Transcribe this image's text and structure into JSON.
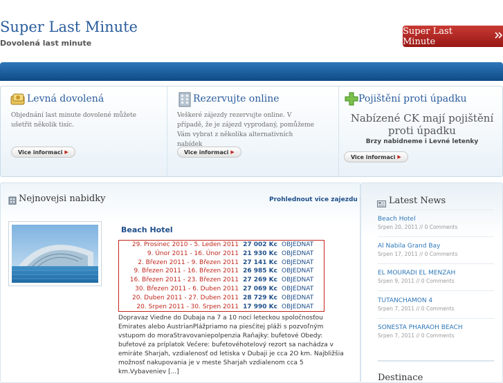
{
  "header": {
    "site_title": "Super Last Minute",
    "tagline": "Dovolená last minute",
    "top_button_label": "Super Last Minute",
    "top_button_icon": "double-chevron-right"
  },
  "features": [
    {
      "title": "Levná dovolená",
      "icon": "money-icon",
      "text": "Objednání last minute dovolené můžete ušetřit několik tisíc.",
      "button": "Vice informaci"
    },
    {
      "title": "Rezervujte online",
      "icon": "building-icon",
      "text": "Veškeré zájezdy rezervujte online. V případě, že je zájezd vyprodaný, pomůžeme Vám vybrat z několika alternativních nabídek",
      "button": "Vice informaci"
    },
    {
      "title": "Pojištění proti úpadku",
      "icon": "plus-icon",
      "big_text": "Nabízené CK mají pojištění proti úpadku",
      "sub_text": "Brzy nabidneme i Levné letenky",
      "button": "Vice informaci"
    }
  ],
  "main": {
    "section_title": "Nejnovejsi nabidky",
    "see_more": "Prohlednout vice zajezdu »",
    "hotel": {
      "title": "Beach Hotel",
      "offers": [
        {
          "dates": "29. Prosinec 2010  -  5. Leden 2011",
          "price": "27 002 Kc",
          "action": "OBJEDNAT"
        },
        {
          "dates": "9. Únor 2011  -  16. Únor 2011",
          "price": "21 930 Kc",
          "action": "OBJEDNAT"
        },
        {
          "dates": "2. Březen 2011  -  9. Březen 2011",
          "price": "27 141 Kc",
          "action": "OBJEDNAT"
        },
        {
          "dates": "9. Březen 2011  -  16. Březen 2011",
          "price": "26 985 Kc",
          "action": "OBJEDNAT"
        },
        {
          "dates": "16. Březen 2011  -  23. Březen 2011",
          "price": "27 269 Kc",
          "action": "OBJEDNAT"
        },
        {
          "dates": "30. Březen 2011  -  6. Duben 2011",
          "price": "27 069 Kc",
          "action": "OBJEDNAT"
        },
        {
          "dates": "20. Duben 2011  -  27. Duben 2011",
          "price": "28 729 Kc",
          "action": "OBJEDNAT"
        },
        {
          "dates": "20. Srpen 2011  -  30. Srpen 2011",
          "price": "17 990 Kc",
          "action": "OBJEDNAT"
        }
      ],
      "description": "Dopravaz Viedne do Dubaja na 7 a 10 nocí leteckou spoločnosťou Emirates alebo AustrianPlážpriamo na piesčitej pláži s pozvoľným vstupom do moraStravovaniepolpenzia Raňajky: bufetové Obedy: bufetové za príplatok Večere: bufetovéhotelový rezort sa nachádza v emiráte Sharjah, vzdialenosť od letiska v Dubaji je cca 2O km. Najbližšia možnosť nakupovania je v meste Sharjah vzdialenom cca 5 km.Vybaveniev [...]"
    }
  },
  "sidebar": {
    "title": "Latest News",
    "items": [
      {
        "title": "Beach Hotel",
        "meta": "Srpen 20, 2011 // 0 Comments"
      },
      {
        "title": "Al Nabila Grand Bay",
        "meta": "Srpen 17, 2011 // 0 Comments"
      },
      {
        "title": "EL MOURADI EL MENZAH",
        "meta": "Srpen 9, 2011 // 0 Comments"
      },
      {
        "title": "TUTANCHAMON 4",
        "meta": "Srpen 7, 2011 // 0 Comments"
      },
      {
        "title": "SONESTA PHARAOH BEACH",
        "meta": "Srpen 7, 2011 // 0 Comments"
      }
    ],
    "next_title": "Destinace"
  }
}
